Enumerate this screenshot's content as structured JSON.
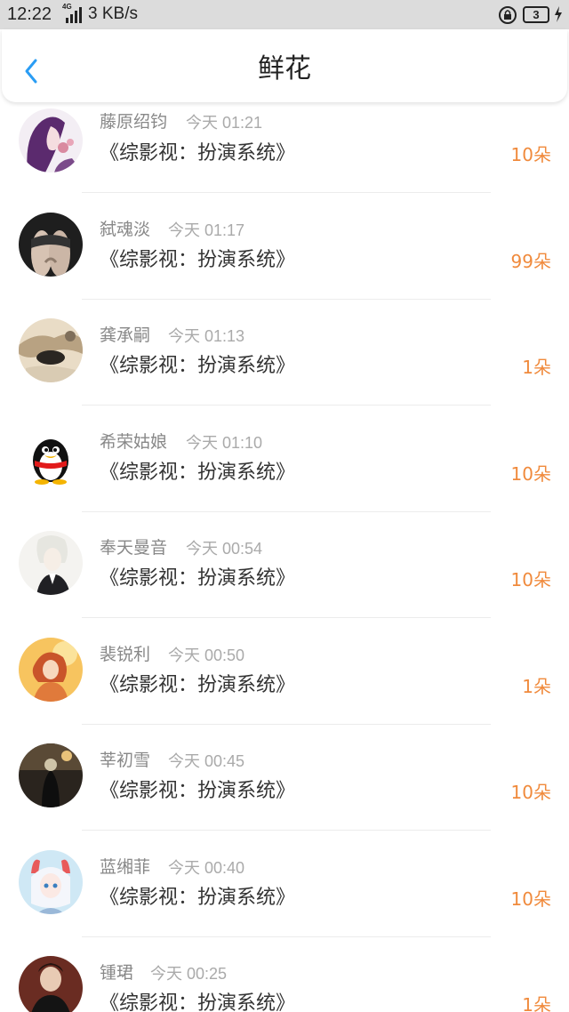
{
  "status_bar": {
    "time": "12:22",
    "network_label": "4G",
    "speed": "3 KB/s",
    "battery": "3"
  },
  "header": {
    "title": "鲜花"
  },
  "colors": {
    "accent_blue": "#2a9df4",
    "count_orange": "#f08a3c"
  },
  "rows": [
    {
      "name": "藤原绍钧",
      "time": "今天 01:21",
      "book": "《综影视：扮演系统》",
      "count": "10朵"
    },
    {
      "name": "弑魂淡",
      "time": "今天 01:17",
      "book": "《综影视：扮演系统》",
      "count": "99朵"
    },
    {
      "name": "龚承嗣",
      "time": "今天 01:13",
      "book": "《综影视：扮演系统》",
      "count": "1朵"
    },
    {
      "name": "希荣姑娘",
      "time": "今天 01:10",
      "book": "《综影视：扮演系统》",
      "count": "10朵"
    },
    {
      "name": "奉天曼音",
      "time": "今天 00:54",
      "book": "《综影视：扮演系统》",
      "count": "10朵"
    },
    {
      "name": "裴锐利",
      "time": "今天 00:50",
      "book": "《综影视：扮演系统》",
      "count": "1朵"
    },
    {
      "name": "莘初雪",
      "time": "今天 00:45",
      "book": "《综影视：扮演系统》",
      "count": "10朵"
    },
    {
      "name": "蓝缃菲",
      "time": "今天 00:40",
      "book": "《综影视：扮演系统》",
      "count": "10朵"
    },
    {
      "name": "锺珺",
      "time": "今天 00:25",
      "book": "《综影视：扮演系统》",
      "count": "1朵"
    }
  ]
}
